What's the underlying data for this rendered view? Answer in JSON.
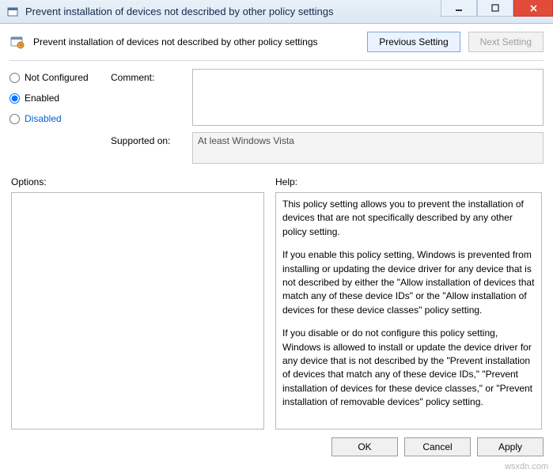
{
  "window": {
    "title": "Prevent installation of devices not described by other policy settings"
  },
  "header": {
    "policy_name": "Prevent installation of devices not described by other policy settings",
    "prev_btn": "Previous Setting",
    "next_btn": "Next Setting"
  },
  "state": {
    "not_configured": "Not Configured",
    "enabled": "Enabled",
    "disabled": "Disabled",
    "selected": "enabled"
  },
  "labels": {
    "comment": "Comment:",
    "supported": "Supported on:",
    "options": "Options:",
    "help": "Help:"
  },
  "fields": {
    "comment_value": "",
    "supported_value": "At least Windows Vista"
  },
  "help": {
    "p1": "This policy setting allows you to prevent the installation of devices that are not specifically described by any other policy setting.",
    "p2": "If you enable this policy setting, Windows is prevented from installing or updating the device driver for any device that is not described by either the \"Allow installation of devices that match any of these device IDs\" or the \"Allow installation of devices for these device classes\" policy setting.",
    "p3": "If you disable or do not configure this policy setting, Windows is allowed to install or update the device driver for any device that is not described by the \"Prevent installation of devices that match any of these device IDs,\" \"Prevent installation of devices for these device classes,\" or \"Prevent installation of removable devices\" policy setting."
  },
  "buttons": {
    "ok": "OK",
    "cancel": "Cancel",
    "apply": "Apply"
  },
  "watermark": "wsxdn.com"
}
